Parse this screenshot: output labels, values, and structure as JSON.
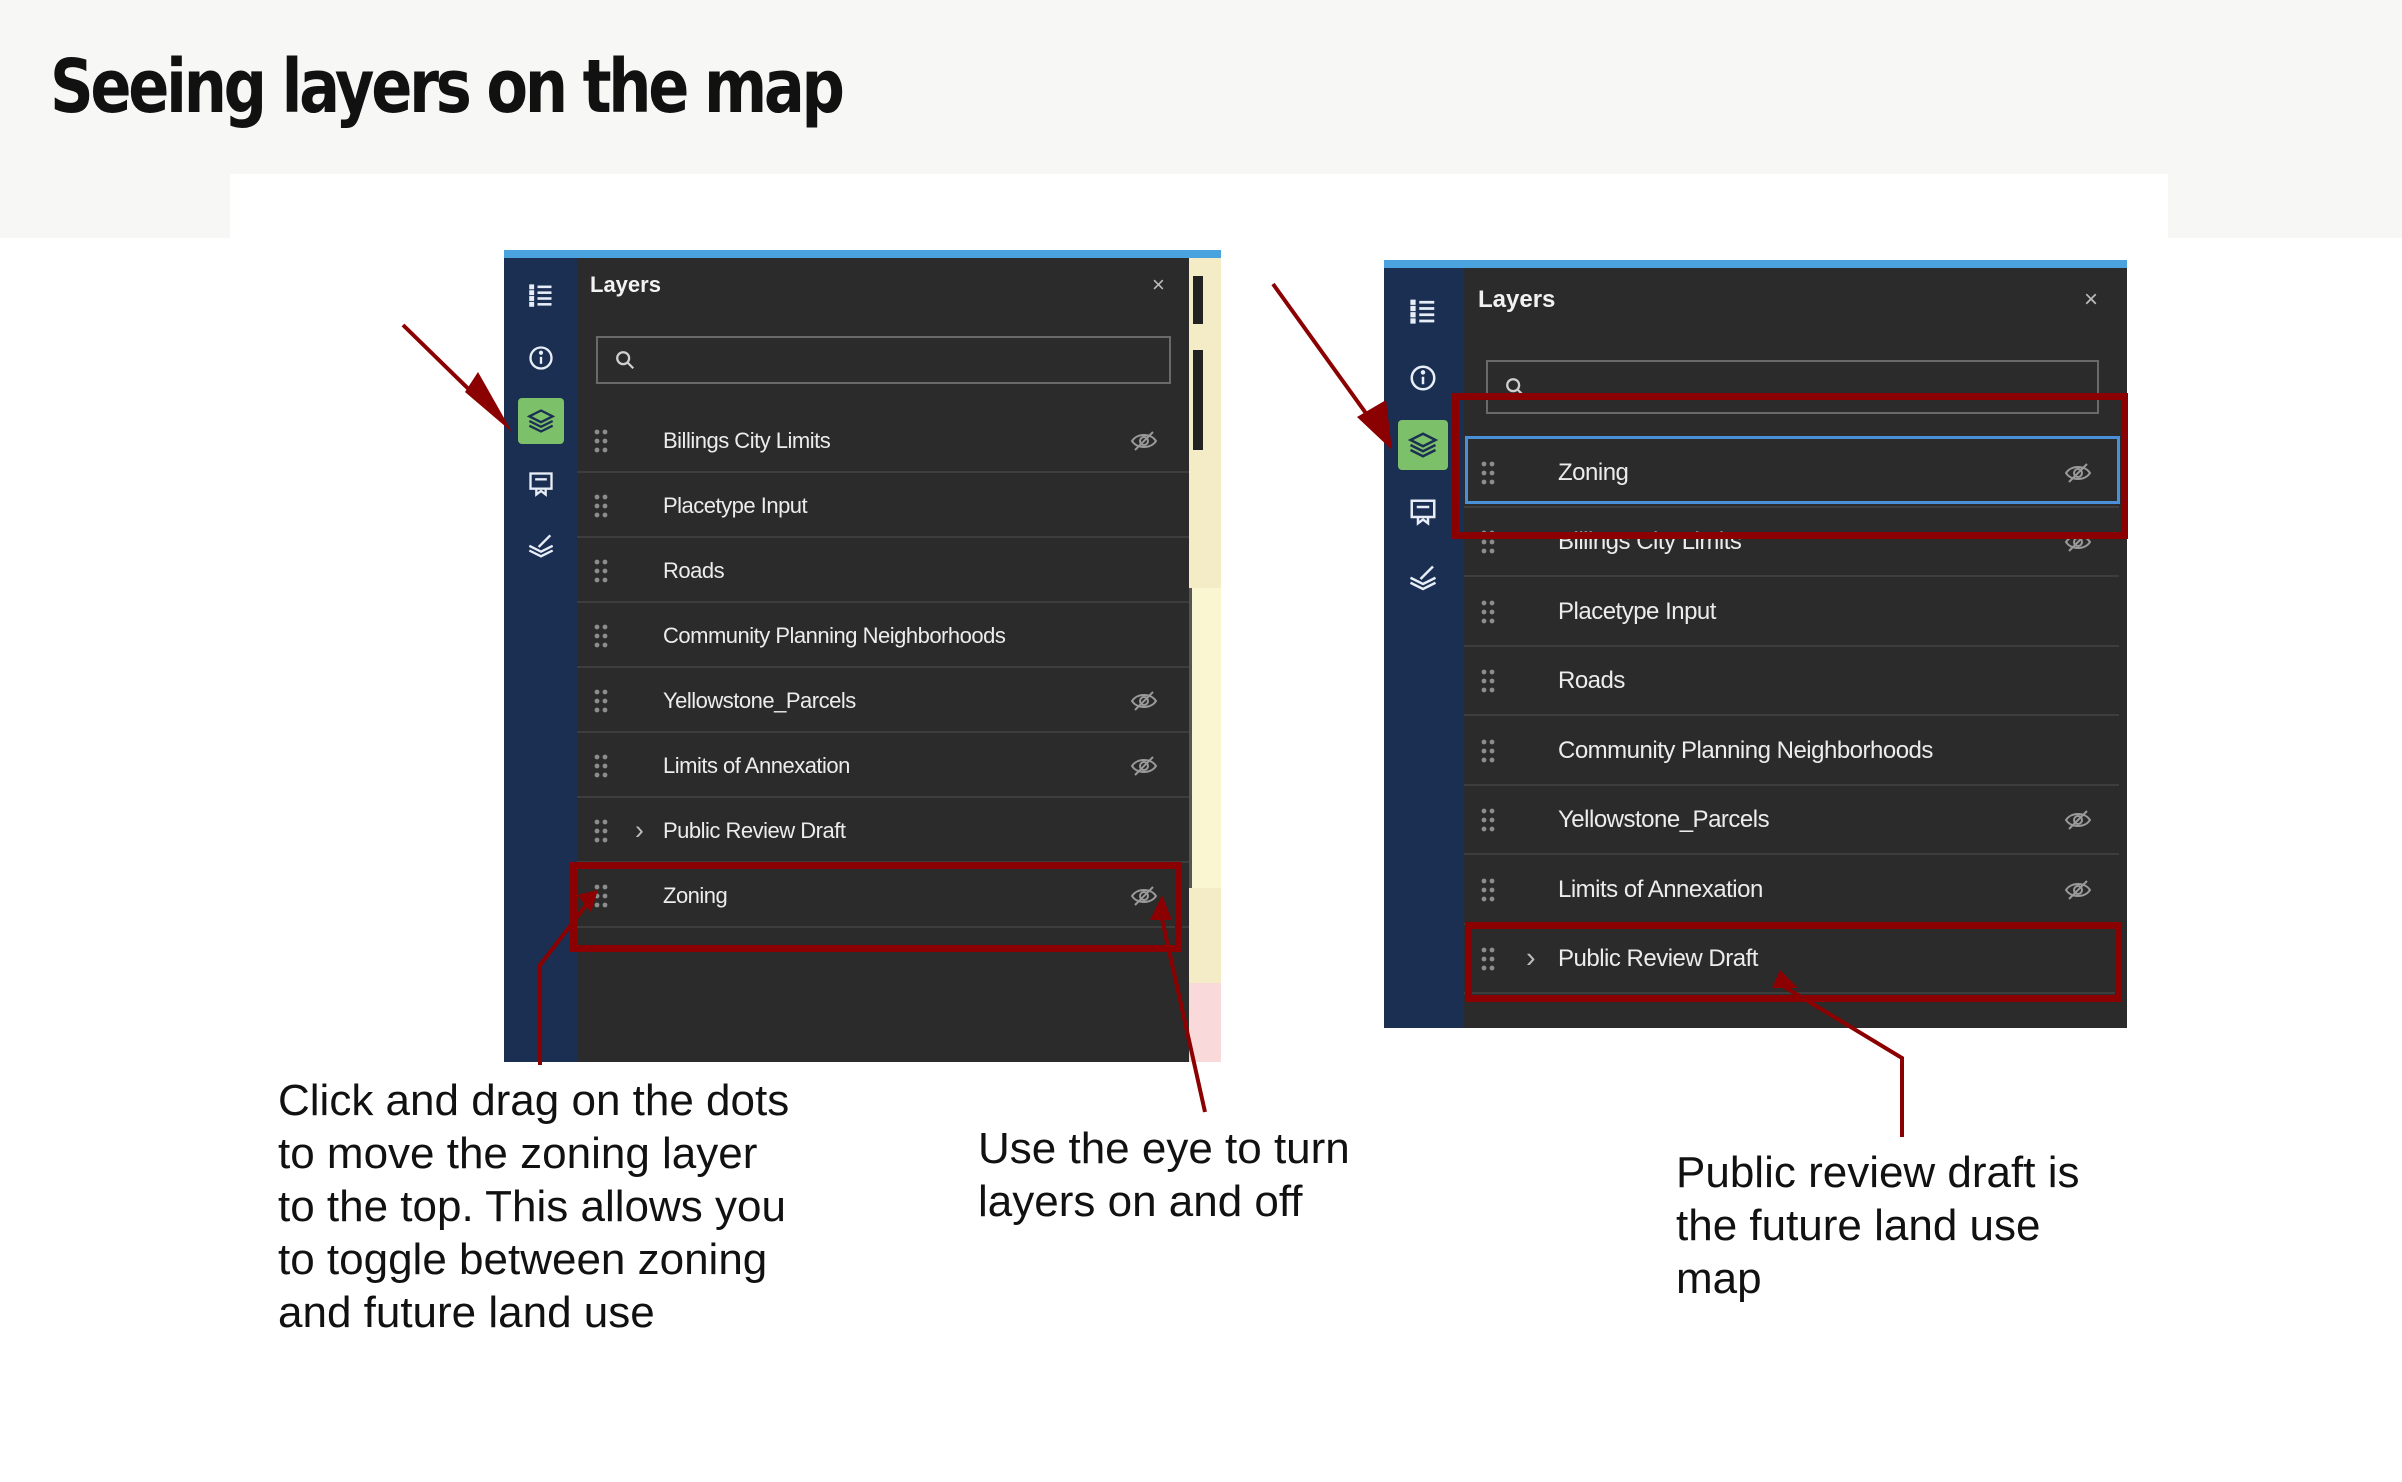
{
  "page": {
    "title": "Seeing layers on the map"
  },
  "colors": {
    "rail": "#1b2f52",
    "panel": "#2b2b2b",
    "active_tool": "#7cc16a",
    "highlight": "#8b0000",
    "focus": "#4a90d9"
  },
  "rail_icons": [
    "legend-list-icon",
    "info-icon",
    "layers-icon",
    "bookmark-icon",
    "sketch-icon"
  ],
  "panel_left": {
    "header": "Layers",
    "close": "×",
    "search_placeholder": "",
    "layers": [
      {
        "label": "Billings City Limits",
        "hidden": true
      },
      {
        "label": "Placetype Input",
        "hidden": false
      },
      {
        "label": "Roads",
        "hidden": false
      },
      {
        "label": "Community Planning Neighborhoods",
        "hidden": false
      },
      {
        "label": "Yellowstone_Parcels",
        "hidden": true
      },
      {
        "label": "Limits of Annexation",
        "hidden": true
      },
      {
        "label": "Public Review Draft",
        "hidden": false,
        "expandable": true
      },
      {
        "label": "Zoning",
        "hidden": true
      }
    ]
  },
  "panel_right": {
    "header": "Layers",
    "close": "×",
    "search_placeholder": "",
    "layers": [
      {
        "label": "Zoning",
        "hidden": true
      },
      {
        "label": "Billings City Limits",
        "hidden": true
      },
      {
        "label": "Placetype Input",
        "hidden": false
      },
      {
        "label": "Roads",
        "hidden": false
      },
      {
        "label": "Community Planning Neighborhoods",
        "hidden": false
      },
      {
        "label": "Yellowstone_Parcels",
        "hidden": true
      },
      {
        "label": "Limits of Annexation",
        "hidden": true
      },
      {
        "label": "Public Review Draft",
        "hidden": false,
        "expandable": true
      }
    ]
  },
  "annotations": {
    "drag": "Click and drag on the dots to move the zoning layer to the top. This allows you to toggle between zoning and future land use",
    "eye": "Use the eye to turn layers on and off",
    "draft": "Public review draft is the future land use map"
  }
}
